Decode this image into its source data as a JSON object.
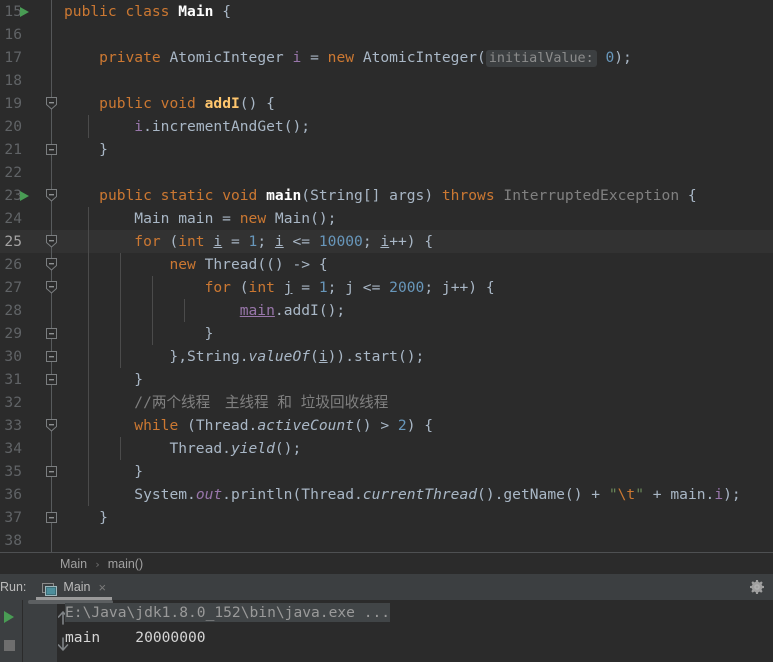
{
  "app": "IntelliJ IDEA",
  "editor": {
    "first_line_number": 15,
    "caret_line_number": 25,
    "lines": [
      {
        "num": "15",
        "run_marker": true,
        "fold": "none"
      },
      {
        "num": "16",
        "run_marker": false,
        "fold": "none"
      },
      {
        "num": "17",
        "run_marker": false,
        "fold": "none"
      },
      {
        "num": "18",
        "run_marker": false,
        "fold": "none"
      },
      {
        "num": "19",
        "run_marker": false,
        "fold": "start"
      },
      {
        "num": "20",
        "run_marker": false,
        "fold": "mid"
      },
      {
        "num": "21",
        "run_marker": false,
        "fold": "end"
      },
      {
        "num": "22",
        "run_marker": false,
        "fold": "none"
      },
      {
        "num": "23",
        "run_marker": true,
        "fold": "start"
      },
      {
        "num": "24",
        "run_marker": false,
        "fold": "mid"
      },
      {
        "num": "25",
        "run_marker": false,
        "fold": "start"
      },
      {
        "num": "26",
        "run_marker": false,
        "fold": "start"
      },
      {
        "num": "27",
        "run_marker": false,
        "fold": "start"
      },
      {
        "num": "28",
        "run_marker": false,
        "fold": "mid"
      },
      {
        "num": "29",
        "run_marker": false,
        "fold": "end"
      },
      {
        "num": "30",
        "run_marker": false,
        "fold": "end"
      },
      {
        "num": "31",
        "run_marker": false,
        "fold": "end"
      },
      {
        "num": "32",
        "run_marker": false,
        "fold": "mid"
      },
      {
        "num": "33",
        "run_marker": false,
        "fold": "start"
      },
      {
        "num": "34",
        "run_marker": false,
        "fold": "mid"
      },
      {
        "num": "35",
        "run_marker": false,
        "fold": "end"
      },
      {
        "num": "36",
        "run_marker": false,
        "fold": "mid"
      },
      {
        "num": "37",
        "run_marker": false,
        "fold": "end"
      },
      {
        "num": "38",
        "run_marker": false,
        "fold": "none"
      }
    ],
    "code_lines": [
      "public class Main {",
      "",
      "    private AtomicInteger i = new AtomicInteger( initialValue: 0);",
      "",
      "    public void addI() {",
      "        i.incrementAndGet();",
      "    }",
      "",
      "    public static void main(String[] args) throws InterruptedException {",
      "        Main main = new Main();",
      "        for (int i = 1; i <= 10000; i++) {",
      "            new Thread(() -> {",
      "                for (int j = 1; j <= 2000; j++) {",
      "                    main.addI();",
      "                }",
      "            },String.valueOf(i)).start();",
      "        }",
      "        //两个线程　主线程 和 垃圾回收线程",
      "        while (Thread.activeCount() > 2) {",
      "            Thread.yield();",
      "        }",
      "        System.out.println(Thread.currentThread().getName() + \"\\t\" + main.i);",
      "    }",
      ""
    ]
  },
  "breadcrumb": {
    "class": "Main",
    "separator": "›",
    "method": "main()"
  },
  "run_window": {
    "label": "Run:",
    "tab_label": "Main",
    "tab_close": "×",
    "tab_icon": "console-icon",
    "settings_icon": "gear-icon"
  },
  "console": {
    "command_line": "E:\\Java\\jdk1.8.0_152\\bin\\java.exe ...",
    "output_thread": "main",
    "output_value": "20000000",
    "output_line": "main    20000000",
    "buttons": {
      "rerun": "rerun-icon",
      "stop": "stop-icon",
      "up": "up-arrow-icon",
      "down": "down-arrow-icon"
    }
  },
  "colors": {
    "editor_bg": "#2b2b2b",
    "panel_bg": "#3c3f41",
    "caret_line": "#323232",
    "default_text": "#a9b7c6",
    "keyword": "#cc7832",
    "method": "#ffc66d",
    "number": "#6897bb",
    "string": "#6a8759",
    "comment": "#808080",
    "field": "#9876aa",
    "run_green": "#499c54",
    "line_number": "#606366"
  }
}
